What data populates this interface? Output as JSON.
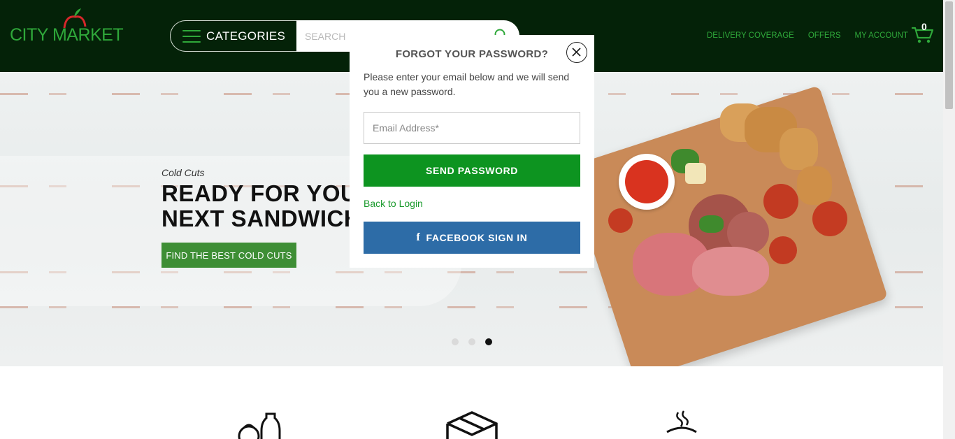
{
  "header": {
    "logo_text": "CITY MARKET",
    "categories_label": "CATEGORIES",
    "search_placeholder": "SEARCH",
    "nav": [
      "DELIVERY COVERAGE",
      "OFFERS",
      "MY ACCOUNT"
    ],
    "cart_count": "0"
  },
  "hero": {
    "kicker": "Cold Cuts",
    "title_line1": "READY FOR YOUR",
    "title_line2": "NEXT SANDWICH",
    "cta_label": "FIND THE BEST COLD CUTS",
    "slides": 3,
    "active_slide": 3
  },
  "modal": {
    "title": "FORGOT YOUR PASSWORD?",
    "description": "Please enter your email below and we will send you a new password.",
    "email_placeholder": "Email Address*",
    "send_label": "SEND PASSWORD",
    "back_label": "Back to Login",
    "facebook_label": "FACEBOOK SIGN IN",
    "facebook_icon": "f"
  },
  "colors": {
    "header_bg": "#042208",
    "brand_green": "#2fa83a",
    "send_green": "#0d9420",
    "facebook_blue": "#2d6ca7",
    "hero_button": "#3e8e35"
  },
  "icons": [
    "search-icon",
    "cart-icon",
    "close-icon",
    "facebook-icon",
    "grocery-icon",
    "box-icon",
    "hot-food-icon"
  ]
}
